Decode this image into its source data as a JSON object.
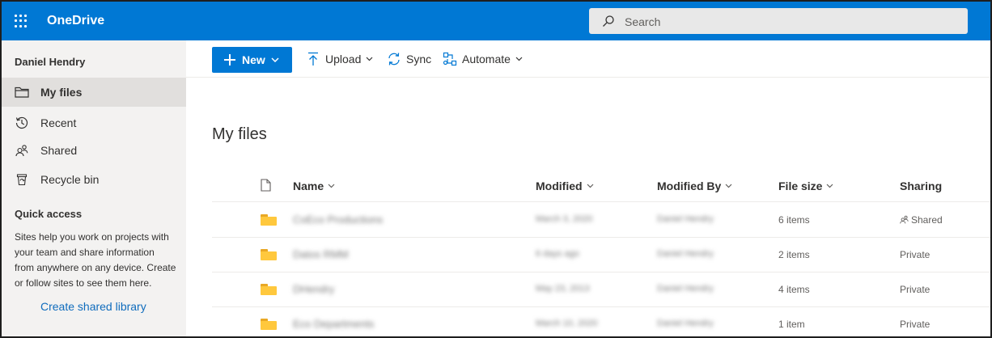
{
  "app": {
    "title": "OneDrive"
  },
  "search": {
    "placeholder": "Search"
  },
  "leftnav": {
    "user": "Daniel Hendry",
    "items": [
      {
        "label": "My files",
        "icon": "folder-outline-icon",
        "active": true
      },
      {
        "label": "Recent",
        "icon": "history-icon",
        "active": false
      },
      {
        "label": "Shared",
        "icon": "people-icon",
        "active": false
      },
      {
        "label": "Recycle bin",
        "icon": "recycle-bin-icon",
        "active": false
      }
    ],
    "quick_access": {
      "title": "Quick access",
      "description": "Sites help you work on projects with your team and share information from anywhere on any device. Create or follow sites to see them here.",
      "link": "Create shared library"
    }
  },
  "commandbar": {
    "new_label": "New",
    "upload_label": "Upload",
    "sync_label": "Sync",
    "automate_label": "Automate"
  },
  "main": {
    "title": "My files",
    "columns": {
      "name": "Name",
      "modified": "Modified",
      "modified_by": "Modified By",
      "file_size": "File size",
      "sharing": "Sharing"
    },
    "rows": [
      {
        "name": "CoEco Productions",
        "modified": "March 3, 2020",
        "modified_by": "Daniel Hendry",
        "file_size": "6 items",
        "sharing": "Shared"
      },
      {
        "name": "Datos RMM",
        "modified": "6 days ago",
        "modified_by": "Daniel Hendry",
        "file_size": "2 items",
        "sharing": "Private"
      },
      {
        "name": "DHendry",
        "modified": "May 23, 2013",
        "modified_by": "Daniel Hendry",
        "file_size": "4 items",
        "sharing": "Private"
      },
      {
        "name": "Eco Departments",
        "modified": "March 10, 2020",
        "modified_by": "Daniel Hendry",
        "file_size": "1 item",
        "sharing": "Private"
      }
    ]
  },
  "colors": {
    "brand": "#0078d4",
    "nav_bg": "#f3f2f1",
    "folder": "#ffc83d"
  }
}
